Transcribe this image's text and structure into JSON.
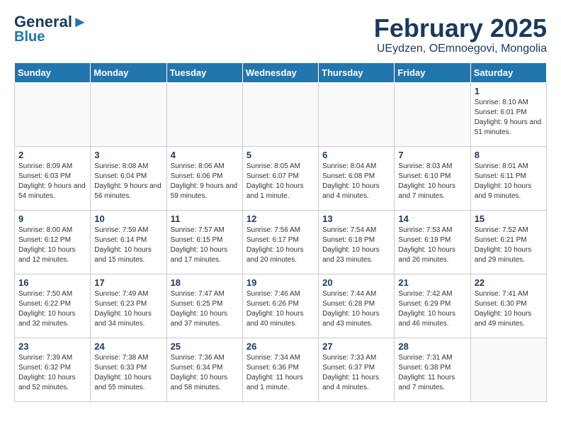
{
  "header": {
    "logo_line1": "General",
    "logo_line2": "Blue",
    "month_title": "February 2025",
    "location": "UEydzen, OEmnoegovi, Mongolia"
  },
  "days_of_week": [
    "Sunday",
    "Monday",
    "Tuesday",
    "Wednesday",
    "Thursday",
    "Friday",
    "Saturday"
  ],
  "weeks": [
    [
      {
        "day": "",
        "content": ""
      },
      {
        "day": "",
        "content": ""
      },
      {
        "day": "",
        "content": ""
      },
      {
        "day": "",
        "content": ""
      },
      {
        "day": "",
        "content": ""
      },
      {
        "day": "",
        "content": ""
      },
      {
        "day": "1",
        "content": "Sunrise: 8:10 AM\nSunset: 6:01 PM\nDaylight: 9 hours and 51 minutes."
      }
    ],
    [
      {
        "day": "2",
        "content": "Sunrise: 8:09 AM\nSunset: 6:03 PM\nDaylight: 9 hours and 54 minutes."
      },
      {
        "day": "3",
        "content": "Sunrise: 8:08 AM\nSunset: 6:04 PM\nDaylight: 9 hours and 56 minutes."
      },
      {
        "day": "4",
        "content": "Sunrise: 8:06 AM\nSunset: 6:06 PM\nDaylight: 9 hours and 59 minutes."
      },
      {
        "day": "5",
        "content": "Sunrise: 8:05 AM\nSunset: 6:07 PM\nDaylight: 10 hours and 1 minute."
      },
      {
        "day": "6",
        "content": "Sunrise: 8:04 AM\nSunset: 6:08 PM\nDaylight: 10 hours and 4 minutes."
      },
      {
        "day": "7",
        "content": "Sunrise: 8:03 AM\nSunset: 6:10 PM\nDaylight: 10 hours and 7 minutes."
      },
      {
        "day": "8",
        "content": "Sunrise: 8:01 AM\nSunset: 6:11 PM\nDaylight: 10 hours and 9 minutes."
      }
    ],
    [
      {
        "day": "9",
        "content": "Sunrise: 8:00 AM\nSunset: 6:12 PM\nDaylight: 10 hours and 12 minutes."
      },
      {
        "day": "10",
        "content": "Sunrise: 7:59 AM\nSunset: 6:14 PM\nDaylight: 10 hours and 15 minutes."
      },
      {
        "day": "11",
        "content": "Sunrise: 7:57 AM\nSunset: 6:15 PM\nDaylight: 10 hours and 17 minutes."
      },
      {
        "day": "12",
        "content": "Sunrise: 7:56 AM\nSunset: 6:17 PM\nDaylight: 10 hours and 20 minutes."
      },
      {
        "day": "13",
        "content": "Sunrise: 7:54 AM\nSunset: 6:18 PM\nDaylight: 10 hours and 23 minutes."
      },
      {
        "day": "14",
        "content": "Sunrise: 7:53 AM\nSunset: 6:19 PM\nDaylight: 10 hours and 26 minutes."
      },
      {
        "day": "15",
        "content": "Sunrise: 7:52 AM\nSunset: 6:21 PM\nDaylight: 10 hours and 29 minutes."
      }
    ],
    [
      {
        "day": "16",
        "content": "Sunrise: 7:50 AM\nSunset: 6:22 PM\nDaylight: 10 hours and 32 minutes."
      },
      {
        "day": "17",
        "content": "Sunrise: 7:49 AM\nSunset: 6:23 PM\nDaylight: 10 hours and 34 minutes."
      },
      {
        "day": "18",
        "content": "Sunrise: 7:47 AM\nSunset: 6:25 PM\nDaylight: 10 hours and 37 minutes."
      },
      {
        "day": "19",
        "content": "Sunrise: 7:46 AM\nSunset: 6:26 PM\nDaylight: 10 hours and 40 minutes."
      },
      {
        "day": "20",
        "content": "Sunrise: 7:44 AM\nSunset: 6:28 PM\nDaylight: 10 hours and 43 minutes."
      },
      {
        "day": "21",
        "content": "Sunrise: 7:42 AM\nSunset: 6:29 PM\nDaylight: 10 hours and 46 minutes."
      },
      {
        "day": "22",
        "content": "Sunrise: 7:41 AM\nSunset: 6:30 PM\nDaylight: 10 hours and 49 minutes."
      }
    ],
    [
      {
        "day": "23",
        "content": "Sunrise: 7:39 AM\nSunset: 6:32 PM\nDaylight: 10 hours and 52 minutes."
      },
      {
        "day": "24",
        "content": "Sunrise: 7:38 AM\nSunset: 6:33 PM\nDaylight: 10 hours and 55 minutes."
      },
      {
        "day": "25",
        "content": "Sunrise: 7:36 AM\nSunset: 6:34 PM\nDaylight: 10 hours and 58 minutes."
      },
      {
        "day": "26",
        "content": "Sunrise: 7:34 AM\nSunset: 6:36 PM\nDaylight: 11 hours and 1 minute."
      },
      {
        "day": "27",
        "content": "Sunrise: 7:33 AM\nSunset: 6:37 PM\nDaylight: 11 hours and 4 minutes."
      },
      {
        "day": "28",
        "content": "Sunrise: 7:31 AM\nSunset: 6:38 PM\nDaylight: 11 hours and 7 minutes."
      },
      {
        "day": "",
        "content": ""
      }
    ]
  ]
}
